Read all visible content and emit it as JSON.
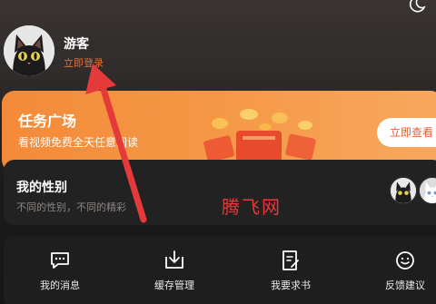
{
  "profile": {
    "username": "游客",
    "login_link": "立即登录"
  },
  "task_card": {
    "title": "任务广场",
    "subtitle": "看视频免费全天任意阅读",
    "button_label": "立即查看"
  },
  "gender_card": {
    "title": "我的性别",
    "subtitle": "不同的性别，不同的精彩"
  },
  "watermark": "腾飞网",
  "tools": [
    {
      "label": "我的消息",
      "icon": "message-icon"
    },
    {
      "label": "缓存管理",
      "icon": "download-icon"
    },
    {
      "label": "我要求书",
      "icon": "request-book-icon"
    },
    {
      "label": "反馈建议",
      "icon": "feedback-icon"
    }
  ],
  "colors": {
    "accent_orange": "#f38a3a",
    "login_link": "#e2703a",
    "annotation_red": "#e53a3a"
  }
}
